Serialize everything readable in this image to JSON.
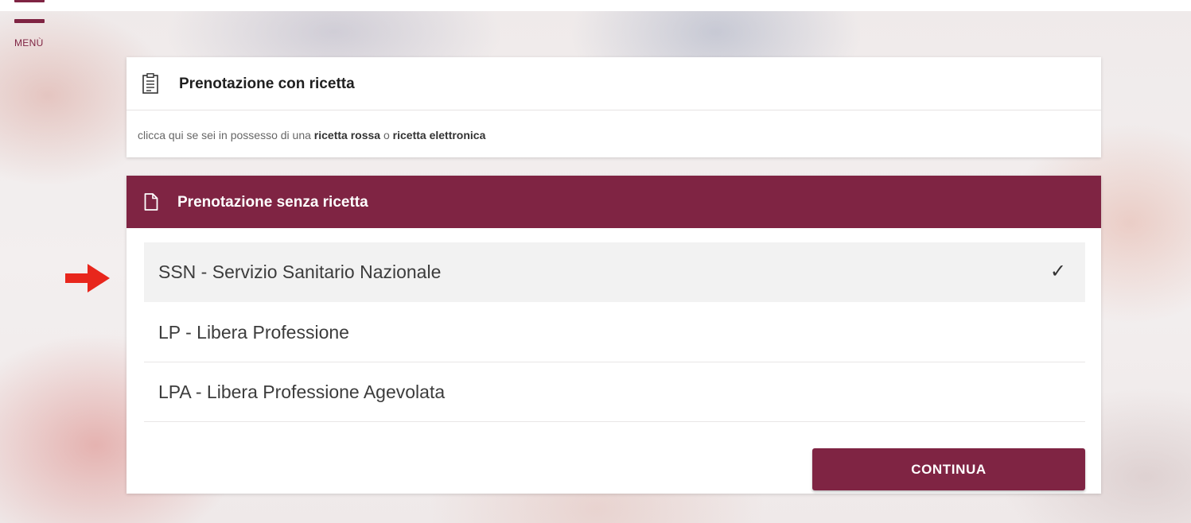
{
  "menu": {
    "label": "MENÙ",
    "icon": "hamburger-icon"
  },
  "card_with_prescription": {
    "icon": "clipboard-icon",
    "title": "Prenotazione con ricetta",
    "subtitle_parts": {
      "prefix": "clicca qui se sei in possesso di una ",
      "bold1": "ricetta rossa",
      "middle": " o ",
      "bold2": "ricetta elettronica"
    }
  },
  "card_without_prescription": {
    "icon": "document-icon",
    "title": "Prenotazione senza ricetta",
    "options": [
      {
        "label": "SSN - Servizio Sanitario Nazionale",
        "selected": true
      },
      {
        "label": "LP - Libera Professione",
        "selected": false
      },
      {
        "label": "LPA - Libera Professione Agevolata",
        "selected": false
      }
    ],
    "check_mark": "✓",
    "continue_label": "CONTINUA"
  },
  "colors": {
    "brand": "#7f2443",
    "arrow": "#e8261c"
  }
}
